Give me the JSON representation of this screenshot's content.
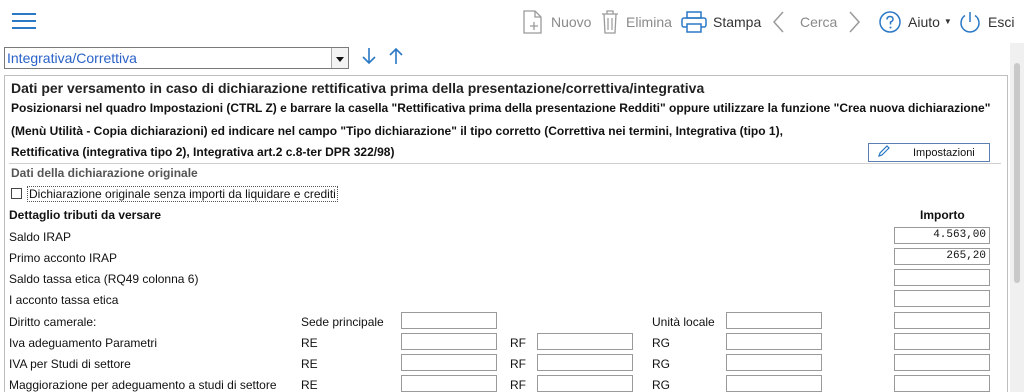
{
  "toolbar": {
    "nuovo": "Nuovo",
    "elimina": "Elimina",
    "stampa": "Stampa",
    "cerca": "Cerca",
    "aiuto": "Aiuto",
    "esci": "Esci"
  },
  "selector": {
    "value": "Integrativa/Correttiva"
  },
  "section": {
    "title": "Dati per versamento in caso di dichiarazione rettificativa prima della presentazione/correttiva/integrativa",
    "line1": "Posizionarsi nel quadro Impostazioni (CTRL Z) e barrare la casella \"Rettificativa prima della presentazione Redditi\" oppure utilizzare la funzione \"Crea nuova dichiarazione\"",
    "line2": "(Menù Utilità - Copia dichiarazioni) ed indicare nel campo \"Tipo dichiarazione\" il tipo corretto (Correttiva nei termini, Integrativa (tipo 1),",
    "line3": "Rettificativa (integrativa tipo 2), Integrativa art.2 c.8-ter DPR 322/98)",
    "impostazioni_label": "Impostazioni"
  },
  "originale": {
    "heading": "Dati della dichiarazione originale",
    "checkbox_label": "Dichiarazione originale senza importi da liquidare e crediti"
  },
  "dettaglio": {
    "heading": "Dettaglio tributi da versare",
    "importo_header": "Importo",
    "rows": {
      "saldo_irap": {
        "label": "Saldo IRAP",
        "importo": "4.563,00"
      },
      "primo_acconto_irap": {
        "label": "Primo acconto IRAP",
        "importo": "265,20"
      },
      "saldo_tassa_etica": {
        "label": "Saldo tassa etica (RQ49 colonna 6)",
        "importo": ""
      },
      "acconto_tassa_etica": {
        "label": "I acconto tassa etica",
        "importo": ""
      },
      "diritto_camerale": {
        "label": "Diritto camerale:",
        "sede": "Sede principale",
        "unita": "Unità locale"
      },
      "iva_parametri": {
        "label": "Iva adeguamento Parametri",
        "re": "RE",
        "rf": "RF",
        "rg": "RG"
      },
      "iva_studi": {
        "label": "IVA per Studi di settore",
        "re": "RE",
        "rf": "RF",
        "rg": "RG"
      },
      "maggiorazione": {
        "label": "Maggiorazione per adeguamento a studi di settore",
        "re": "RE",
        "rf": "RF",
        "rg": "RG"
      }
    }
  }
}
